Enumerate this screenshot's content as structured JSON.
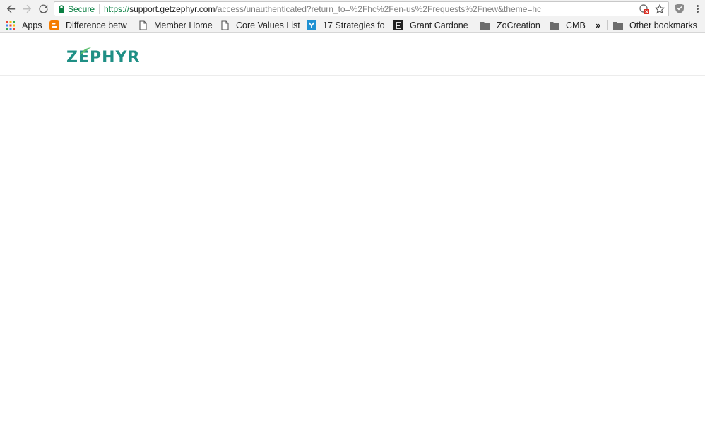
{
  "browser": {
    "omnibox": {
      "secure_label": "Secure",
      "url_scheme": "https://",
      "url_host": "support.getzephyr.com",
      "url_path": "/access/unauthenticated?return_to=%2Fhc%2Fen-us%2Frequests%2Fnew&theme=hc"
    },
    "bookmarks": [
      {
        "label": "Apps",
        "icon": "apps-grid-icon"
      },
      {
        "label": "Difference betw",
        "icon": "blogger-icon"
      },
      {
        "label": "Member Home",
        "icon": "page-icon"
      },
      {
        "label": "Core Values List",
        "icon": "page-icon"
      },
      {
        "label": "17 Strategies fo",
        "icon": "y-icon"
      },
      {
        "label": "Grant Cardone -",
        "icon": "e-icon"
      },
      {
        "label": "ZoCreation",
        "icon": "folder-icon"
      },
      {
        "label": "CMB",
        "icon": "folder-icon"
      },
      {
        "label": "»",
        "icon": ""
      },
      {
        "label": "Other bookmarks",
        "icon": "folder-icon"
      }
    ]
  },
  "page": {
    "logo_text": "ZEPHYR",
    "brand_color": "#1f8f85"
  }
}
